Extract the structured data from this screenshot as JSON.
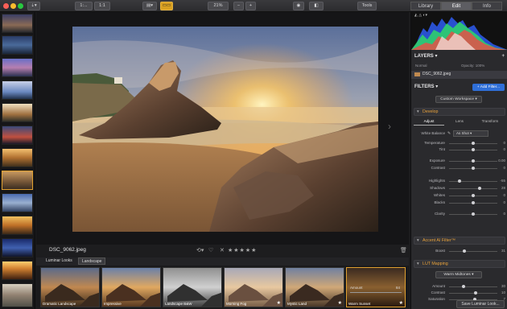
{
  "toolbar": {
    "zoom_button": "1:...",
    "zoom_100": "1:1",
    "zoom_pct": "21%",
    "tools": "Tools",
    "tabs": [
      "Library",
      "Edit",
      "Info"
    ],
    "active_tab": "Edit"
  },
  "canvas": {
    "filename": "DSC_9062.jpeg"
  },
  "looks_bar": {
    "label": "Luminar Looks",
    "category": "Landscape"
  },
  "looks": [
    {
      "label": "Dramatic Landscape"
    },
    {
      "label": "Impressive"
    },
    {
      "label": "Landscape B&W"
    },
    {
      "label": "Morning Fog"
    },
    {
      "label": "Mystic Land"
    },
    {
      "label": "Warm Sunset"
    }
  ],
  "look_amount": {
    "label": "Amount",
    "value": "84"
  },
  "panel": {
    "layers_title": "LAYERS",
    "blend_mode": "Normal",
    "opacity_label": "Opacity: 100%",
    "layer_name": "DSC_9062.jpeg",
    "filters_title": "FILTERS",
    "add_filter": "+ Add Filter...",
    "workspace": "Custom Workspace",
    "develop": {
      "title": "Develop",
      "tabs": [
        "Adjust",
        "Lens",
        "Transform"
      ],
      "white_balance_label": "White Balance",
      "white_balance_value": "As Shot",
      "sliders": [
        {
          "label": "Temperature",
          "value": "0",
          "pos": 0.5
        },
        {
          "label": "Tint",
          "value": "0",
          "pos": 0.5
        },
        {
          "label": "Exposure",
          "value": "0.00",
          "pos": 0.5
        },
        {
          "label": "Contrast",
          "value": "0",
          "pos": 0.5
        },
        {
          "label": "Highlights",
          "value": "-55",
          "pos": 0.22
        },
        {
          "label": "Shadows",
          "value": "28",
          "pos": 0.64
        },
        {
          "label": "Whites",
          "value": "0",
          "pos": 0.5
        },
        {
          "label": "Blacks",
          "value": "0",
          "pos": 0.5
        },
        {
          "label": "Clarity",
          "value": "0",
          "pos": 0.5
        }
      ]
    },
    "accent": {
      "title": "Accent AI Filter™",
      "slider": {
        "label": "Boost",
        "value": "31",
        "pos": 0.31
      }
    },
    "lut": {
      "title": "LUT Mapping",
      "preset": "Warm Midtones",
      "sliders": [
        {
          "label": "Amount",
          "value": "30",
          "pos": 0.3
        },
        {
          "label": "Contrast",
          "value": "10",
          "pos": 0.55
        },
        {
          "label": "Saturation",
          "value": "7",
          "pos": 0.53
        }
      ]
    },
    "save_button": "Save Luminar Look..."
  },
  "colors": {
    "accent": "#e0a030",
    "add_filter_blue": "#2f6fd8"
  }
}
